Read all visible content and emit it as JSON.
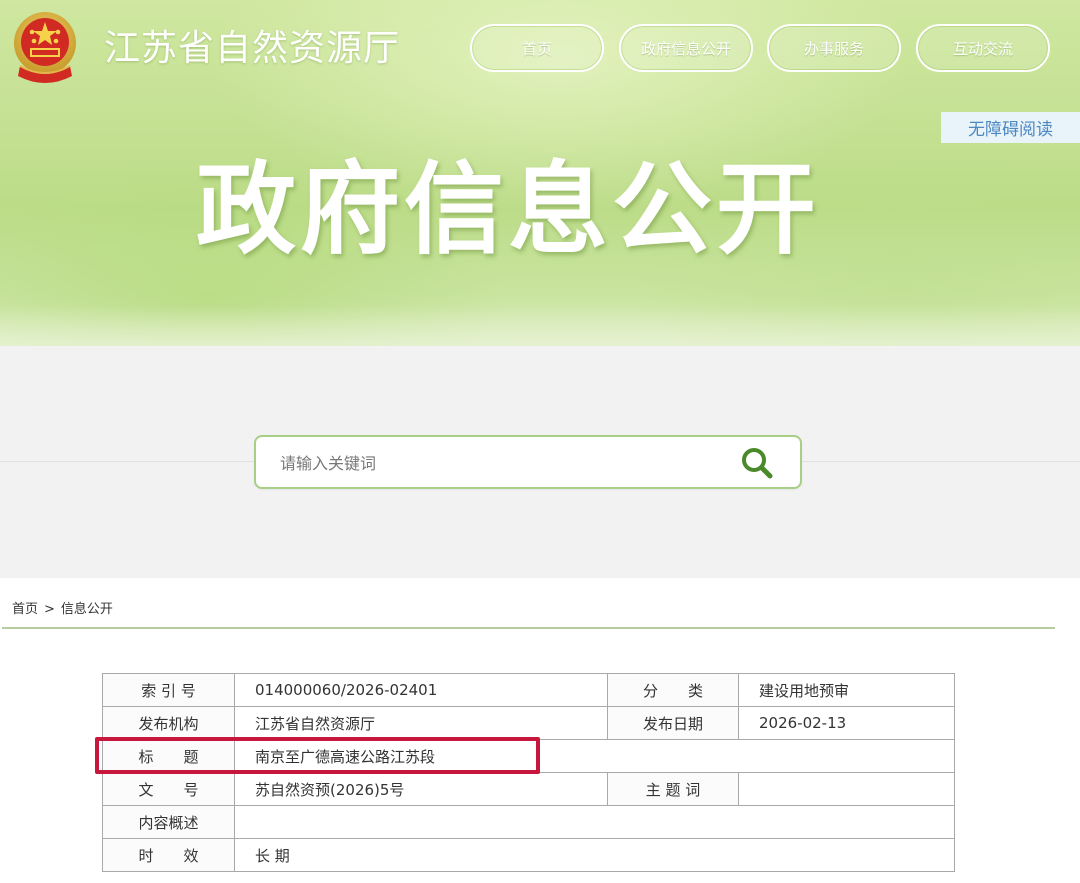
{
  "header": {
    "site_name": "江苏省自然资源厅",
    "nav": [
      {
        "label": "首页"
      },
      {
        "label": "政府信息公开"
      },
      {
        "label": "办事服务"
      },
      {
        "label": "互动交流"
      }
    ],
    "accessibility_link": "无障碍阅读",
    "banner_title": "政府信息公开"
  },
  "search": {
    "placeholder": "请输入关键词"
  },
  "breadcrumb": {
    "items": [
      "首页",
      "信息公开"
    ],
    "separator": ">"
  },
  "info_table": {
    "rows": [
      {
        "label1": "索 引 号",
        "value1": "014000060/2026-02401",
        "label2": "分　　类",
        "value2": "建设用地预审"
      },
      {
        "label1": "发布机构",
        "value1": "江苏省自然资源厅",
        "label2": "发布日期",
        "value2": "2026-02-13"
      },
      {
        "label1": "标　　题",
        "value1": "南京至广德高速公路江苏段"
      },
      {
        "label1": "文　　号",
        "value1": "苏自然资预(2026)5号",
        "label2": "主 题 词",
        "value2": ""
      },
      {
        "label1": "内容概述",
        "value1": ""
      },
      {
        "label1": "时　　效",
        "value1": "长 期"
      }
    ]
  },
  "colors": {
    "nav_border": "#ffffff",
    "search_border": "#a9ce86",
    "search_icon": "#4a8a2a",
    "highlight": "#c8173d",
    "divider": "#b7cc9f"
  },
  "icons": {
    "emblem": "national-emblem-icon",
    "search": "search-icon"
  }
}
